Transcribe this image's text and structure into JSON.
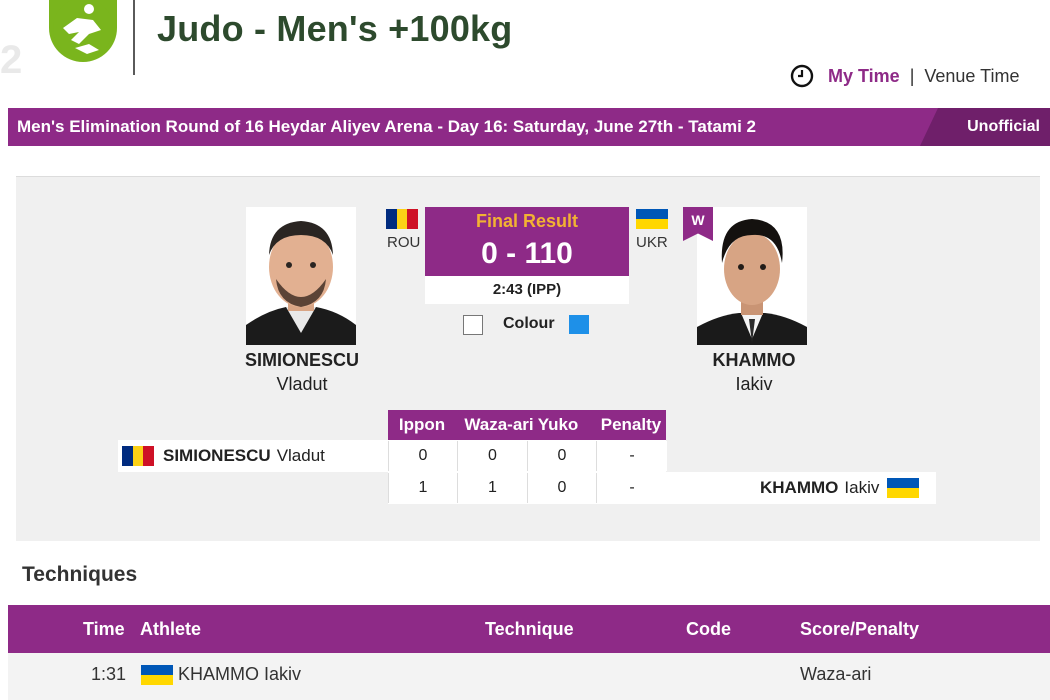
{
  "header": {
    "title": "Judo - Men's +100kg",
    "time_toggle": {
      "my_time": "My Time",
      "venue_time": "Venue Time"
    }
  },
  "banner": {
    "event": "Men's Elimination Round of 16  Heydar Aliyev Arena - Day 16: Saturday, June 27th - Tatami 2",
    "status": "Unofficial"
  },
  "match": {
    "result_label": "Final Result",
    "score": "0 - 110",
    "duration": "2:43 (IPP)",
    "colour_label": "Colour",
    "winner_badge": "W",
    "left": {
      "last_name": "SIMIONESCU",
      "first_name": "Vladut",
      "noc": "ROU",
      "colour": "#ffffff"
    },
    "right": {
      "last_name": "KHAMMO",
      "first_name": "Iakiv",
      "noc": "UKR",
      "colour": "#1e90e8"
    }
  },
  "score_grid": {
    "headers": [
      "Ippon",
      "Waza-ari",
      "Yuko",
      "Penalty"
    ],
    "rows": [
      {
        "last_name": "SIMIONESCU",
        "first_name": "Vladut",
        "values": [
          "0",
          "0",
          "0",
          "-"
        ]
      },
      {
        "last_name": "KHAMMO",
        "first_name": "Iakiv",
        "values": [
          "1",
          "1",
          "0",
          "-"
        ]
      }
    ]
  },
  "techniques": {
    "title": "Techniques",
    "headers": {
      "time": "Time",
      "athlete": "Athlete",
      "technique": "Technique",
      "code": "Code",
      "score": "Score/Penalty"
    },
    "rows": [
      {
        "time": "1:31",
        "athlete": "KHAMMO Iakiv",
        "technique": "",
        "code": "",
        "score": "Waza-ari"
      }
    ]
  },
  "colors": {
    "accent_purple": "#8e2a87",
    "result_gold": "#f2b233",
    "logo_green": "#7ab51d",
    "rou_flag": [
      "#002b7f",
      "#fcd116",
      "#ce1126"
    ],
    "ukr_flag": [
      "#0057b7",
      "#ffd700"
    ]
  },
  "icons": [
    "judo-logo-icon",
    "clock-icon",
    "rou-flag-icon",
    "ukr-flag-icon"
  ]
}
